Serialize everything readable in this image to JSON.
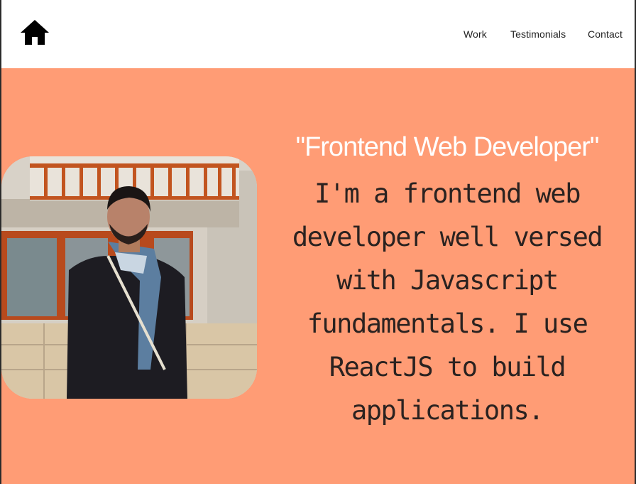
{
  "nav": {
    "home_icon": "home-icon",
    "links": [
      "Work",
      "Testimonials",
      "Contact"
    ]
  },
  "hero": {
    "tagline": "\"Frontend Web Developer\"",
    "bio": "I'm a frontend web developer well versed with Javascript fundamentals. I use ReactJS to build applications.",
    "photo_alt": "profile-photo"
  },
  "colors": {
    "hero_background": "#FF9C75",
    "tagline_text": "#FFFFFF",
    "bio_text": "#2A2220",
    "nav_background": "#FFFFFF"
  }
}
